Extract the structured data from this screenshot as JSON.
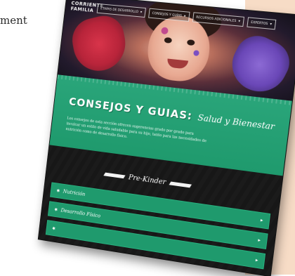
{
  "document": {
    "fragment_text": "ment"
  },
  "site": {
    "logo_text": "CORRIENTE FAMILIA",
    "nav": [
      {
        "label": "ETAPAS DE DESARROLLO"
      },
      {
        "label": "CONSEJOS Y GUÍAS"
      },
      {
        "label": "RECURSOS ADICIONALES"
      },
      {
        "label": "EXPERTOS"
      }
    ],
    "section": {
      "title": "CONSEJOS Y GUIAS:",
      "subtitle": "Salud y Bienestar",
      "description": "Los consejos de esta sección ofrecen sugerencias grado por grado para inculcar un estilo de vida saludable para su hijo, tanto para las necesidades de nutrición como de desarrollo físico."
    },
    "level_label": "Pre-Kinder",
    "accordion": [
      {
        "label": "Nutrición"
      },
      {
        "label": "Desarrollo Físico"
      },
      {
        "label": ""
      }
    ]
  }
}
